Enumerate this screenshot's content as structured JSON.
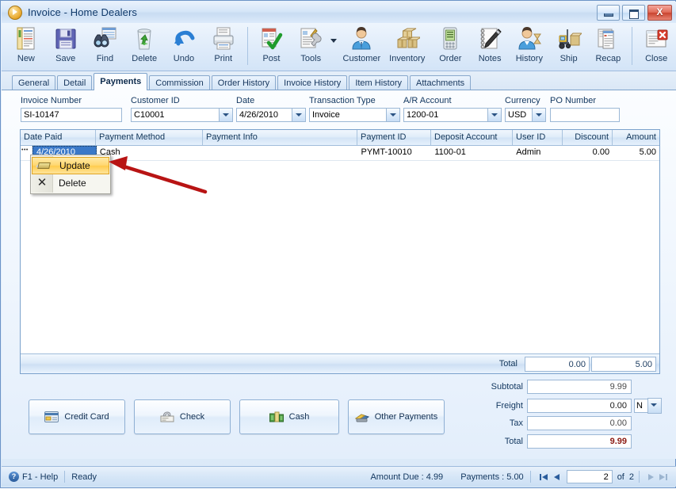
{
  "window": {
    "title": "Invoice - Home Dealers",
    "title_icon": "play-circle-icon",
    "controls": {
      "minimize": "minimize-icon",
      "maximize": "maximize-icon",
      "close": "X"
    }
  },
  "toolbar": {
    "items": [
      {
        "label": "New",
        "icon": "new-document-icon"
      },
      {
        "label": "Save",
        "icon": "floppy-disk-icon"
      },
      {
        "label": "Find",
        "icon": "binoculars-icon"
      },
      {
        "label": "Delete",
        "icon": "recycle-bin-icon"
      },
      {
        "label": "Undo",
        "icon": "undo-arrow-icon"
      },
      {
        "label": "Print",
        "icon": "printer-icon"
      },
      {
        "label": "Post",
        "icon": "post-checkmark-icon"
      },
      {
        "label": "Tools",
        "icon": "tools-wrench-icon",
        "has_dropdown": true
      },
      {
        "label": "Customer",
        "icon": "customer-person-icon"
      },
      {
        "label": "Inventory",
        "icon": "inventory-boxes-icon"
      },
      {
        "label": "Order",
        "icon": "order-device-icon"
      },
      {
        "label": "Notes",
        "icon": "notepad-pen-icon"
      },
      {
        "label": "History",
        "icon": "history-person-clock-icon"
      },
      {
        "label": "Ship",
        "icon": "forklift-ship-icon"
      },
      {
        "label": "Recap",
        "icon": "recap-report-icon"
      },
      {
        "label": "Close",
        "icon": "close-window-icon"
      }
    ]
  },
  "tabs": {
    "items": [
      {
        "label": "General",
        "active": false
      },
      {
        "label": "Detail",
        "active": false
      },
      {
        "label": "Payments",
        "active": true
      },
      {
        "label": "Commission",
        "active": false
      },
      {
        "label": "Order History",
        "active": false
      },
      {
        "label": "Invoice History",
        "active": false
      },
      {
        "label": "Item History",
        "active": false
      },
      {
        "label": "Attachments",
        "active": false
      }
    ]
  },
  "form": {
    "invoice_number": {
      "label": "Invoice Number",
      "value": "SI-10147",
      "type": "text"
    },
    "customer_id": {
      "label": "Customer ID",
      "value": "C10001",
      "type": "combo"
    },
    "date": {
      "label": "Date",
      "value": "4/26/2010",
      "type": "combo"
    },
    "transaction_type": {
      "label": "Transaction Type",
      "value": "Invoice",
      "type": "combo"
    },
    "ar_account": {
      "label": "A/R Account",
      "value": "1200-01",
      "type": "combo"
    },
    "currency": {
      "label": "Currency",
      "value": "USD",
      "type": "combo"
    },
    "po_number": {
      "label": "PO Number",
      "value": "",
      "type": "text"
    }
  },
  "grid": {
    "columns": [
      {
        "label": "Date Paid",
        "align": "left"
      },
      {
        "label": "Payment Method",
        "align": "left"
      },
      {
        "label": "Payment Info",
        "align": "left"
      },
      {
        "label": "Payment ID",
        "align": "left"
      },
      {
        "label": "Deposit Account",
        "align": "left"
      },
      {
        "label": "User ID",
        "align": "left"
      },
      {
        "label": "Discount",
        "align": "right"
      },
      {
        "label": "Amount",
        "align": "right"
      }
    ],
    "rows": [
      {
        "date_paid": "4/26/2010",
        "payment_method": "Cash",
        "payment_info": "",
        "payment_id": "PYMT-10010",
        "deposit_account": "1100-01",
        "user_id": "Admin",
        "discount": "0.00",
        "amount": "5.00",
        "selected_cell": "date_paid"
      }
    ],
    "totals": {
      "label": "Total",
      "discount": "0.00",
      "amount": "5.00"
    }
  },
  "context_menu": {
    "items": [
      {
        "label": "Update",
        "icon": "pencil-edit-icon",
        "selected": true
      },
      {
        "label": "Delete",
        "icon": "x-delete-icon",
        "selected": false
      }
    ]
  },
  "payment_buttons": [
    {
      "label": "Credit Card",
      "icon": "credit-card-icon"
    },
    {
      "label": "Check",
      "icon": "check-hand-icon"
    },
    {
      "label": "Cash",
      "icon": "cash-money-icon"
    },
    {
      "label": "Other Payments",
      "icon": "other-payments-icon"
    }
  ],
  "summary": {
    "subtotal": {
      "label": "Subtotal",
      "value": "9.99"
    },
    "freight": {
      "label": "Freight",
      "value": "0.00",
      "type_value": "N"
    },
    "tax": {
      "label": "Tax",
      "value": "0.00"
    },
    "total": {
      "label": "Total",
      "value": "9.99"
    }
  },
  "statusbar": {
    "help": "F1 - Help",
    "state": "Ready",
    "amount_due": "Amount Due : 4.99",
    "payments": "Payments : 5.00",
    "record": "2",
    "of_label": "of",
    "record_total": "2"
  },
  "colors": {
    "accent": "#3a78c8",
    "total_highlight": "#8b1a12",
    "menu_highlight": "#ffd770",
    "annotation": "#b81414"
  }
}
